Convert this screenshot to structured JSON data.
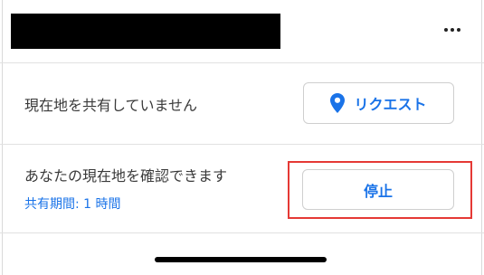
{
  "header": {
    "contact_name": "",
    "more_menu_icon": "ellipsis-icon"
  },
  "location_request": {
    "status_text": "現在地を共有していません",
    "request_button_label": "リクエスト",
    "request_button_icon": "location-pin-icon"
  },
  "location_sharing": {
    "status_text": "あなたの現在地を確認できます",
    "duration_text": "共有期間: 1 時間",
    "stop_button_label": "停止"
  },
  "colors": {
    "accent": "#1a73e8",
    "highlight": "#e53935",
    "text": "#3a3a3a",
    "divider": "#e1e1e1"
  }
}
